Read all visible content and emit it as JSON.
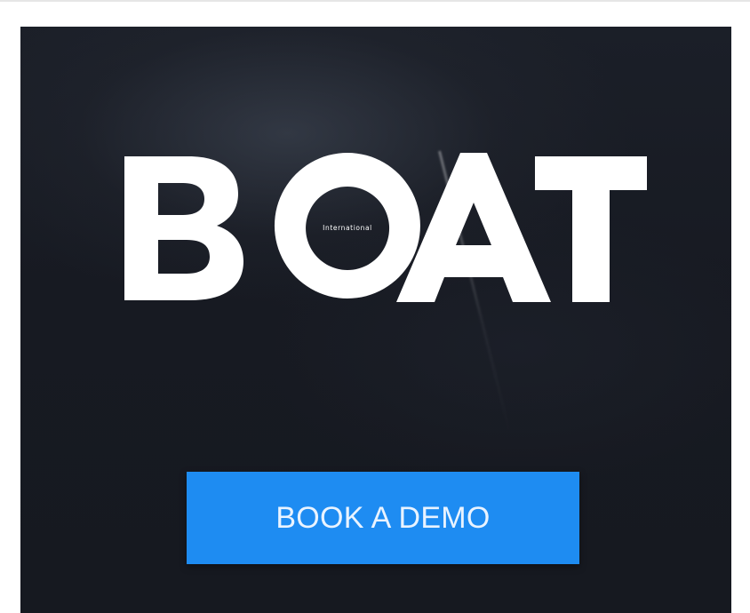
{
  "ad": {
    "logo": {
      "letters": [
        "B",
        "O",
        "A",
        "T"
      ],
      "inner_label": "International"
    },
    "cta_label": "BOOK A DEMO"
  },
  "colors": {
    "background": "#171a22",
    "logo": "#ffffff",
    "cta": "#1e8cf2",
    "cta_text": "#e9f3ff"
  },
  "icons": {
    "logo": "boat-international-logo"
  }
}
